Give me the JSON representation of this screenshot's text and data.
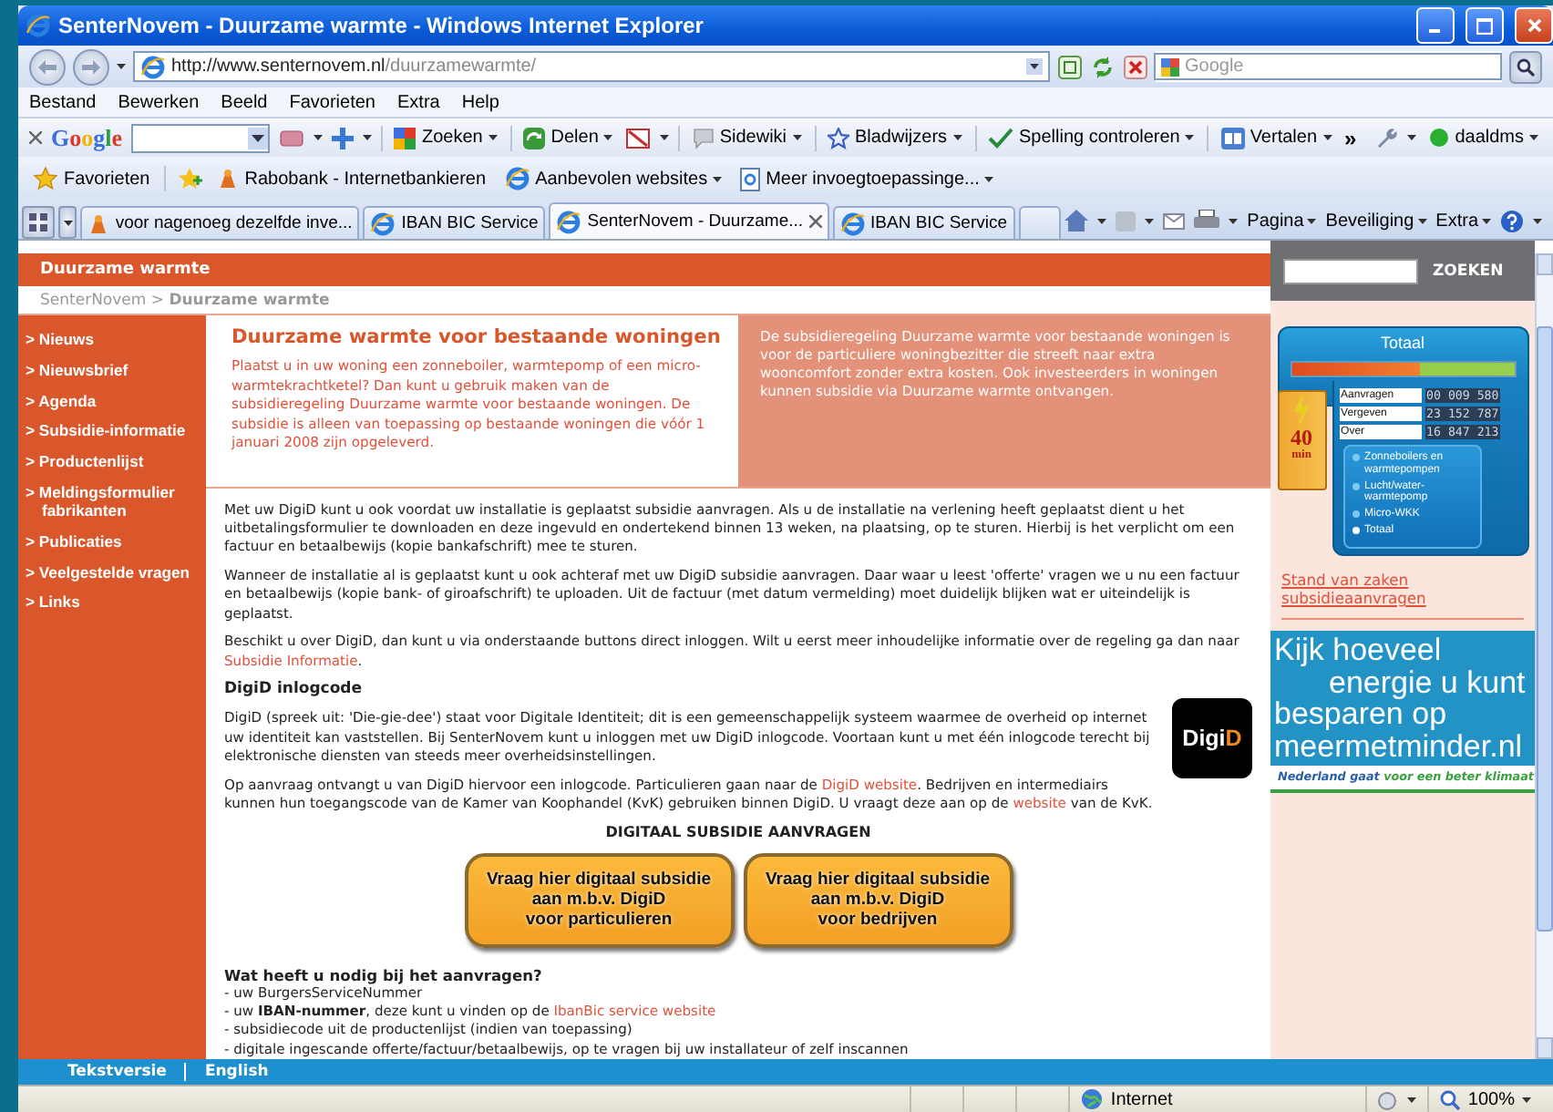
{
  "window": {
    "title": "SenterNovem - Duurzame warmte - Windows Internet Explorer"
  },
  "address_bar": {
    "url_host": "http://www.senternovem.nl",
    "url_path": "/duurzamewarmte/"
  },
  "search_box": {
    "placeholder": "Google"
  },
  "menu": [
    "Bestand",
    "Bewerken",
    "Beeld",
    "Favorieten",
    "Extra",
    "Help"
  ],
  "google_toolbar": {
    "logo": "Google",
    "items": [
      {
        "kind": "search",
        "label": "Zoeken"
      },
      {
        "kind": "share",
        "label": "Delen"
      },
      {
        "kind": "sidewiki",
        "label": "Sidewiki"
      },
      {
        "kind": "bookmarks",
        "label": "Bladwijzers"
      },
      {
        "kind": "spelling",
        "label": "Spelling controleren"
      },
      {
        "kind": "translate",
        "label": "Vertalen"
      }
    ],
    "more": "»",
    "account": "daaldms"
  },
  "favorites_bar": {
    "label": "Favorieten",
    "items": [
      "Rabobank - Internetbankieren",
      "Aanbevolen websites",
      "Meer invoegtoepassinge..."
    ]
  },
  "tabs": [
    {
      "label": "voor nagenoeg dezelfde inve...",
      "selected": false
    },
    {
      "label": "IBAN BIC Service",
      "selected": false
    },
    {
      "label": "SenterNovem - Duurzame...",
      "selected": true
    },
    {
      "label": "IBAN BIC Service",
      "selected": false
    }
  ],
  "command_bar": [
    "Pagina",
    "Beveiliging",
    "Extra"
  ],
  "page": {
    "header": "Duurzame warmte",
    "breadcrumb": "SenterNovem > **Duurzame warmte**",
    "search_button": "ZOEKEN",
    "nav": [
      "> Nieuws",
      "> Nieuwsbrief",
      "> Agenda",
      "> Subsidie-informatie",
      "> Productenlijst",
      "> Meldingsformulier fabrikanten",
      "> Publicaties",
      "> Veelgestelde vragen",
      "> Links"
    ],
    "intro": {
      "title": "Duurzame warmte voor bestaande woningen",
      "text": "Plaatst u in uw woning een zonneboiler, warmtepomp of een micro-warmtekrachtketel? Dan kunt u gebruik maken van de subsidieregeling Duurzame warmte voor bestaande woningen. De subsidie is alleen van toepassing op bestaande woningen die vóór 1 januari 2008 zijn opgeleverd."
    },
    "aside": "De subsidieregeling Duurzame warmte voor bestaande woningen is voor de particuliere woningbezitter die streeft naar extra wooncomfort zonder extra kosten. Ook investeerders in woningen kunnen subsidie via Duurzame warmte ontvangen.",
    "paragraphs": [
      [
        {
          "kind": "text",
          "text": "Met uw DigiD kunt u ook voordat uw installatie is geplaatst subsidie aanvragen. Als u de installatie na verlening heeft geplaatst dient u het uitbetalingsformulier te downloaden en deze ingevuld en ondertekend binnen 13 weken, na plaatsing, op te sturen. Hierbij is het verplicht om een factuur en betaalbewijs (kopie bankafschrift) mee te sturen."
        }
      ],
      [
        {
          "kind": "text",
          "text": "Wanneer de installatie al is geplaatst kunt u ook achteraf met uw DigiD subsidie aanvragen. Daar waar u leest 'offerte' vragen we u nu een factuur en betaalbewijs (kopie bank- of giroafschrift) te uploaden. Uit de factuur (met datum vermelding) moet duidelijk blijken wat er uiteindelijk is geplaatst."
        }
      ],
      [
        {
          "kind": "text",
          "text": "Beschikt u over DigiD, dan kunt u via onderstaande buttons direct inloggen. Wilt u eerst meer inhoudelijke informatie over de regeling ga dan naar "
        },
        {
          "kind": "link",
          "text": "Subsidie Informatie"
        },
        {
          "kind": "text",
          "text": "."
        }
      ]
    ],
    "digid": {
      "heading": "DigiD inlogcode",
      "logo": {
        "text": "Digi",
        "accent": "D"
      },
      "paragraphs": [
        [
          {
            "kind": "text",
            "text": "DigiD (spreek uit: 'Die-gie-dee') staat voor Digitale Identiteit; dit is een gemeenschappelijk systeem waarmee de overheid op internet uw identiteit kan vaststellen. Bij SenterNovem kunt u inloggen met uw DigiD inlogcode. Voortaan kunt u met één inlogcode terecht bij elektronische diensten van steeds meer overheidsinstellingen."
          }
        ],
        [
          {
            "kind": "text",
            "text": "Op aanvraag ontvangt u van DigiD hiervoor een inlogcode. Particulieren gaan naar de "
          },
          {
            "kind": "link",
            "text": "DigiD website"
          },
          {
            "kind": "text",
            "text": ". Bedrijven en intermediairs kunnen hun toegangscode van de Kamer van Koophandel (KvK) gebruiken binnen DigiD. U vraagt deze aan op de "
          },
          {
            "kind": "link",
            "text": "website"
          },
          {
            "kind": "text",
            "text": " van de KvK."
          }
        ]
      ]
    },
    "apply": {
      "heading": "DIGITAAL SUBSIDIE AANVRAGEN",
      "buttons": [
        "Vraag hier digitaal subsidie\naan m.b.v. DigiD\nvoor particulieren",
        "Vraag hier digitaal subsidie\naan m.b.v. DigiD\nvoor bedrijven"
      ]
    },
    "requirements": {
      "heading": "Wat heeft u nodig bij het aanvragen?",
      "items": [
        [
          {
            "kind": "text",
            "text": "- uw BurgersServiceNummer"
          }
        ],
        [
          {
            "kind": "text",
            "text": "- uw **IBAN-nummer**, deze kunt u vinden op de "
          },
          {
            "kind": "link",
            "text": "IbanBic service website"
          }
        ],
        [
          {
            "kind": "text",
            "text": "- subsidiecode uit de productenlijst (indien van toepassing)"
          }
        ],
        [
          {
            "kind": "text",
            "text": "- digitale ingescande offerte/factuur/betaalbewijs, op te vragen bij uw installateur of zelf inscannen"
          }
        ]
      ]
    },
    "widget": {
      "title": "Totaal",
      "level": 0.58,
      "battery_value": "40",
      "battery_unit": "min",
      "rows": [
        {
          "label": "Aanvragen",
          "value": "00 009 580"
        },
        {
          "label": "Vergeven",
          "value": "23 152 787"
        },
        {
          "label": "Over",
          "value": "16 847 213"
        }
      ],
      "legend": [
        {
          "label": "Zonneboilers en warmtepompen",
          "selected": false
        },
        {
          "label": "Lucht/water-warmtepomp",
          "selected": false
        },
        {
          "label": "Micro-WKK",
          "selected": false
        },
        {
          "label": "Totaal",
          "selected": true
        }
      ]
    },
    "sidebar_link": "Stand van zaken subsidieaanvragen",
    "banner": {
      "lines": [
        "Kijk hoeveel",
        "energie u kunt",
        "besparen op",
        "meermetminder.nl"
      ],
      "tagline_a": "Nederland gaat",
      "tagline_b": "voor een beter klimaat"
    },
    "footer": [
      "Tekstversie",
      "English"
    ]
  },
  "status_bar": {
    "zone": "Internet",
    "zoom": "100%"
  }
}
